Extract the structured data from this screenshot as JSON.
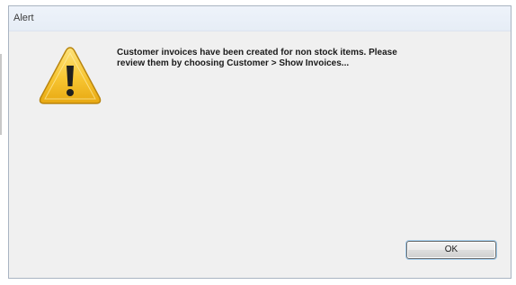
{
  "window": {
    "title": "Alert"
  },
  "alert": {
    "icon": "warning-icon",
    "message_line1": "Customer invoices have been created for non stock items. Please",
    "message_line2": "review them by choosing Customer > Show Invoices..."
  },
  "buttons": {
    "ok_label": "OK"
  },
  "colors": {
    "dialog_background": "#f0f0f0",
    "warning_yellow": "#f7c531",
    "button_focus_glow": "#9cc6e6"
  }
}
